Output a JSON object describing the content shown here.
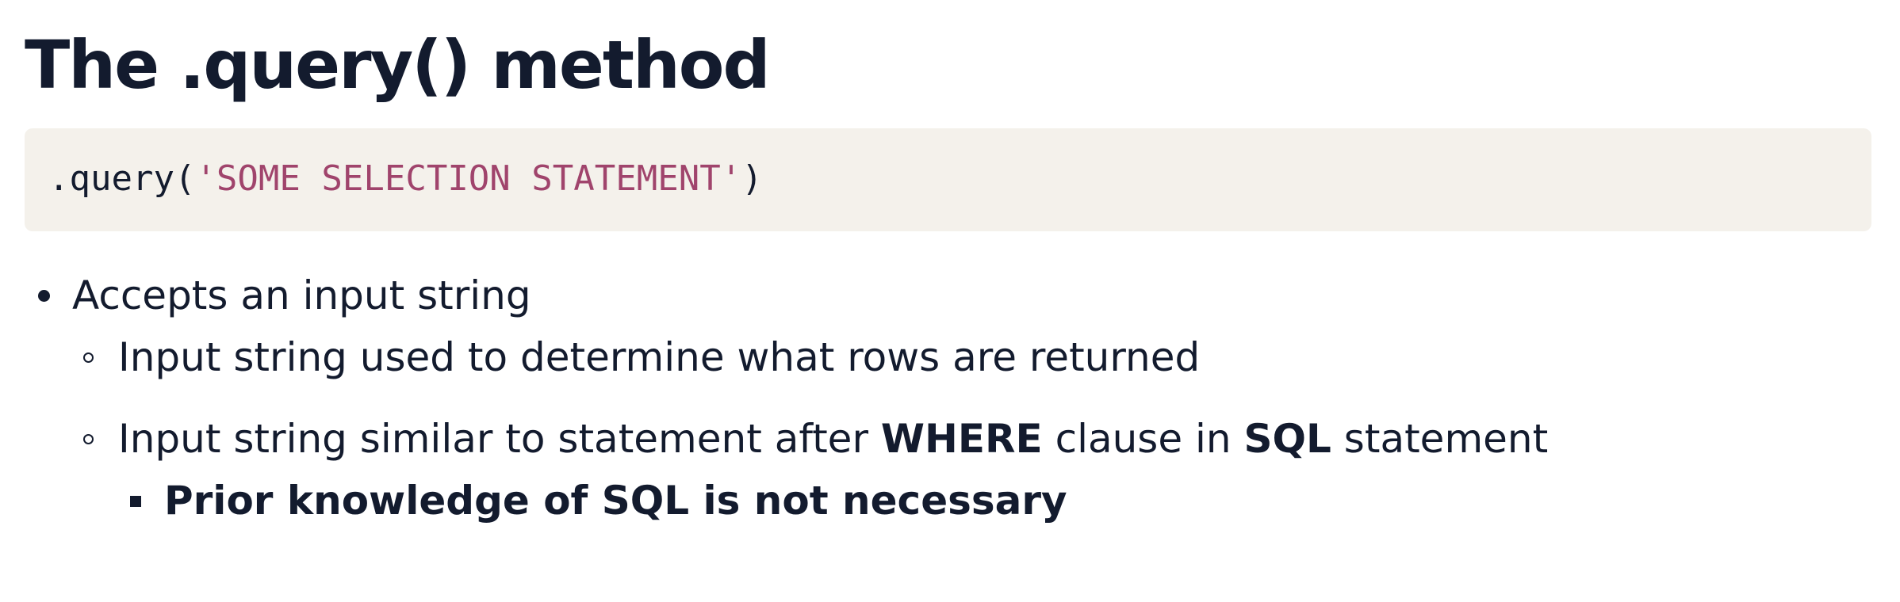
{
  "slide": {
    "title": "The .query() method",
    "code": {
      "prefix": ".query(",
      "string": "'SOME SELECTION STATEMENT'",
      "suffix": ")"
    },
    "bullets": {
      "item1": "Accepts an input string",
      "item1_sub1": "Input string used to determine what rows are returned",
      "item1_sub2": {
        "part1": "Input string similar to statement after ",
        "bold1": "WHERE",
        "part2": " clause in ",
        "bold2": "SQL",
        "part3": " statement"
      },
      "item1_sub2_sub1": "Prior knowledge of SQL is not necessary"
    }
  }
}
